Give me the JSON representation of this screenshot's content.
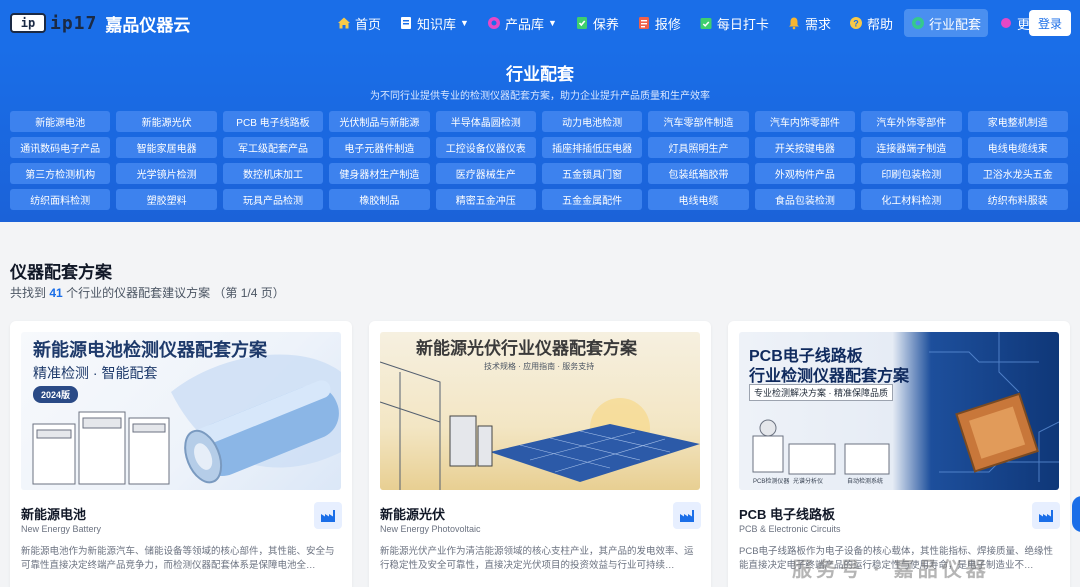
{
  "header": {
    "logo_mark": "ip",
    "logo_text": "ip17",
    "site_name": "嘉品仪器云",
    "nav": [
      {
        "label": "首页",
        "icon": "home-icon",
        "caret": false
      },
      {
        "label": "知识库",
        "icon": "book-icon",
        "caret": true
      },
      {
        "label": "产品库",
        "icon": "product-icon",
        "caret": true
      },
      {
        "label": "保养",
        "icon": "shield-check-icon",
        "caret": false
      },
      {
        "label": "报修",
        "icon": "repair-icon",
        "caret": false
      },
      {
        "label": "每日打卡",
        "icon": "calendar-check-icon",
        "caret": false
      },
      {
        "label": "需求",
        "icon": "bell-icon",
        "caret": false
      },
      {
        "label": "帮助",
        "icon": "help-icon",
        "caret": false
      },
      {
        "label": "行业配套",
        "icon": "industry-icon",
        "caret": false
      },
      {
        "label": "更多",
        "icon": "more-icon",
        "caret": true
      }
    ],
    "login": "登录"
  },
  "hero": {
    "title": "行业配套",
    "subtitle": "为不同行业提供专业的检测仪器配套方案，助力企业提升产品质量和生产效率",
    "tags": [
      "新能源电池",
      "新能源光伏",
      "PCB 电子线路板",
      "光伏制品与新能源",
      "半导体晶圆检测",
      "动力电池检测",
      "汽车零部件制造",
      "汽车内饰零部件",
      "汽车外饰零部件",
      "家电整机制造",
      "通讯数码电子产品",
      "智能家居电器",
      "军工级配套产品",
      "电子元器件制造",
      "工控设备仪器仪表",
      "插座排插低压电器",
      "灯具照明生产",
      "开关按键电器",
      "连接器端子制造",
      "电线电缆线束",
      "第三方检测机构",
      "光学镜片检测",
      "数控机床加工",
      "健身器材生产制造",
      "医疗器械生产",
      "五金锁具门窗",
      "包装纸箱胶带",
      "外观构件产品",
      "印刷包装检测",
      "卫浴水龙头五金",
      "纺织面料检测",
      "塑胶塑料",
      "玩具产品检测",
      "橡胶制品",
      "精密五金冲压",
      "五金金属配件",
      "电线电缆",
      "食品包装检测",
      "化工材料检测",
      "纺织布料服装"
    ]
  },
  "solutions": {
    "title": "仪器配套方案",
    "count_prefix": "共找到",
    "count": "41",
    "count_suffix": "个行业的仪器配套建议方案  （第 1/4 页）",
    "cards": [
      {
        "name": "新能源电池",
        "en": "New Energy Battery",
        "desc": "新能源电池作为新能源汽车、储能设备等领域的核心部件，其性能、安全与可靠性直接决定终端产品竞争力，而检测仪器配套体系是保障电池全…",
        "img_title": "新能源电池检测仪器配套方案",
        "img_sub": "精准检测 · 智能配套",
        "img_badge": "2024版"
      },
      {
        "name": "新能源光伏",
        "en": "New Energy Photovoltaic",
        "desc": "新能源光伏产业作为清洁能源领域的核心支柱产业，其产品的发电效率、运行稳定性及安全可靠性，直接决定光伏项目的投资效益与行业可持续…",
        "img_title": "新能源光伏行业仪器配套方案",
        "img_sub": "技术规格 · 应用指南 · 服务支持"
      },
      {
        "name": "PCB 电子线路板",
        "en": "PCB & Electronic Circuits",
        "desc": "PCB电子线路板作为电子设备的核心载体，其性能指标、焊接质量、绝缘性能直接决定电子终端产品的运行稳定性与使用寿命，是电子制造业不…",
        "img_title_1": "PCB电子线路板",
        "img_title_2": "行业检测仪器配套方案",
        "img_sub": "专业检测解决方案 · 精准保障品质",
        "img_labels": [
          "PCB检测仪器",
          "光谱分析仪",
          "自动检测系统"
        ]
      }
    ]
  },
  "watermark": "服务号 · 嘉品仪器",
  "colors": {
    "brand": "#1a6ee8",
    "tag_bg": "#3d82ee",
    "active_nav": "#4a8ff0"
  }
}
